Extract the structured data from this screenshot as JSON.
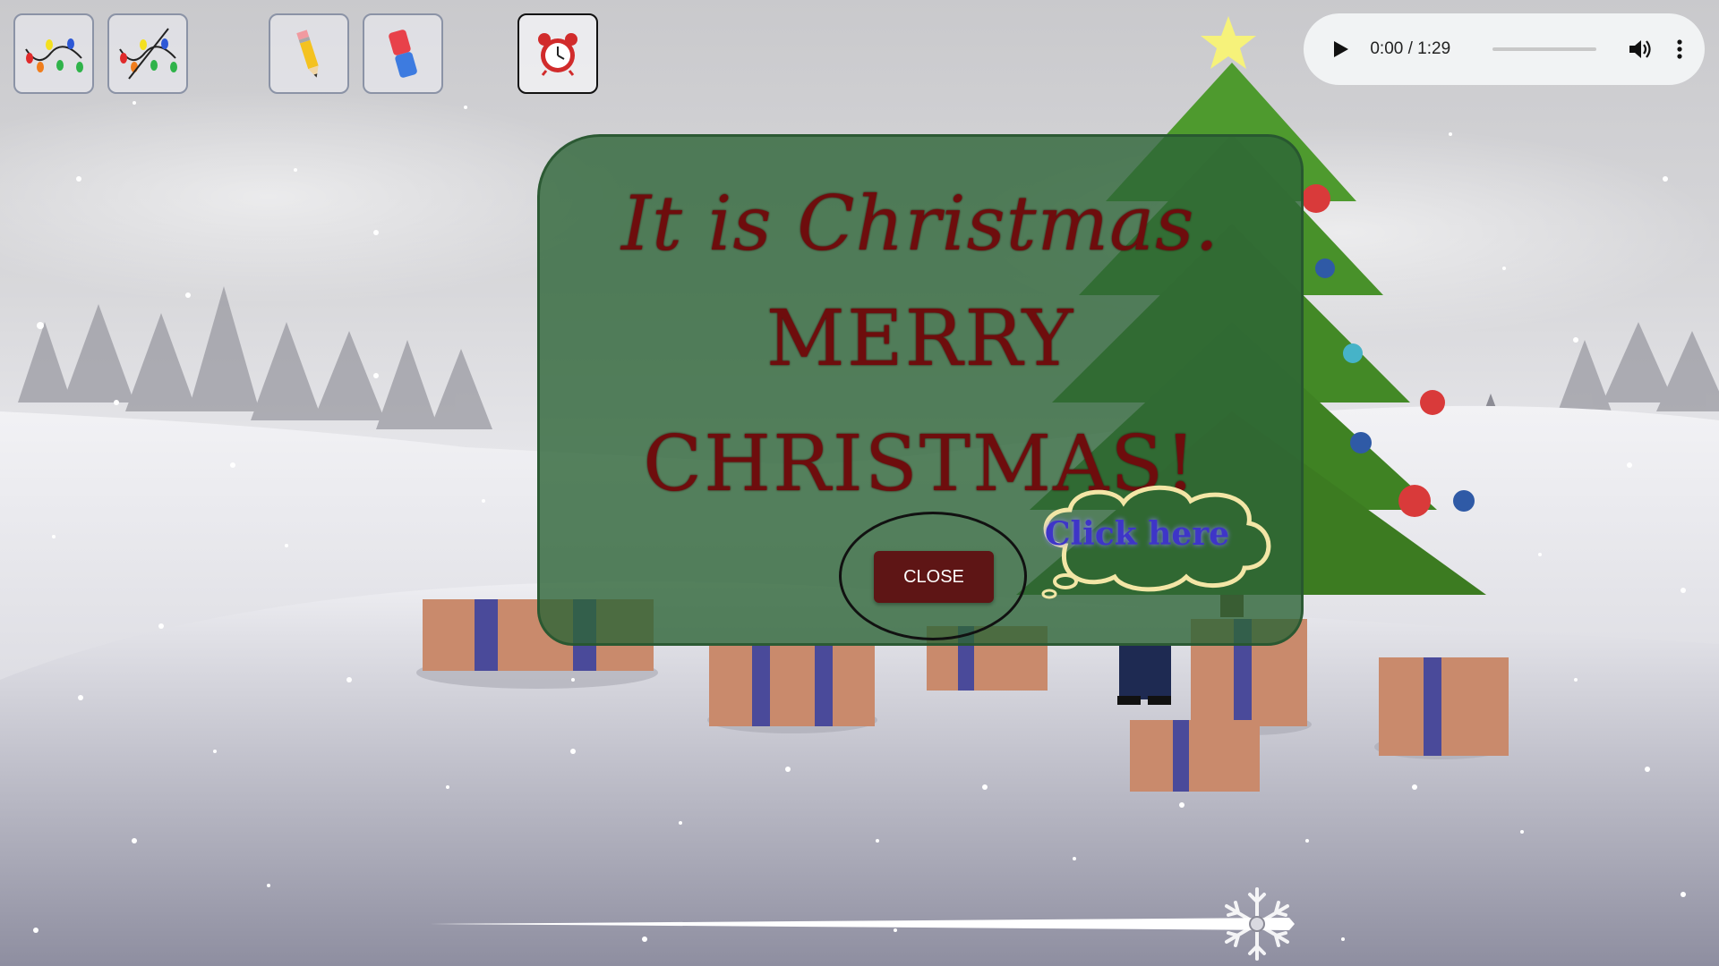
{
  "toolbar": {
    "lights_on": {
      "icon": "string-lights-icon"
    },
    "lights_off": {
      "icon": "string-lights-off-icon"
    },
    "pencil": {
      "icon": "pencil-icon"
    },
    "eraser": {
      "icon": "eraser-icon"
    },
    "alarm": {
      "icon": "alarm-clock-icon"
    }
  },
  "audio": {
    "time": "0:00 / 1:29",
    "progress": 0
  },
  "modal": {
    "line1": "It is Christmas.",
    "line2": "MERRY",
    "line3": "CHRISTMAS!",
    "close_label": "CLOSE",
    "hint": "Click here"
  },
  "slider": {
    "value": 0.97
  },
  "colors": {
    "modal_bg": "#2d6437",
    "title_text": "#6e0d0d",
    "close_button": "#5e1515",
    "hint_text": "#3e35c8",
    "hint_cloud": "#f3e6a6"
  }
}
